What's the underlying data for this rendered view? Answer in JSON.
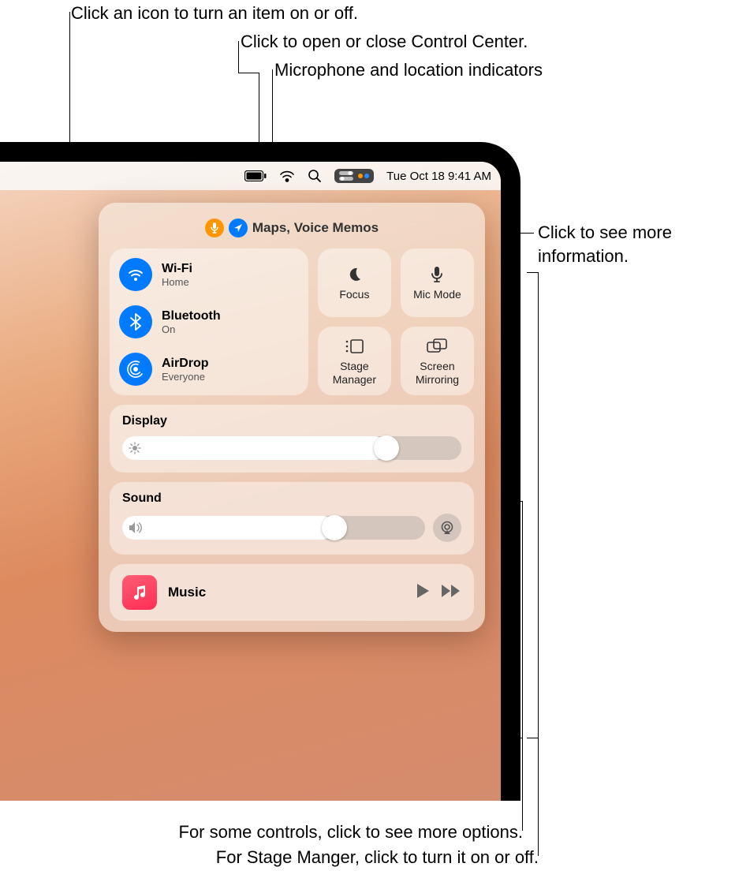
{
  "callouts": {
    "toggle": "Click an icon to turn an item on or off.",
    "open_close": "Click to open or close Control Center.",
    "indicators": "Microphone and location indicators",
    "more_info_1": "Click to see more",
    "more_info_2": "information.",
    "bottom1": "For some controls, click to see more options.",
    "bottom2": "For Stage Manger, click to turn it on or off."
  },
  "menubar": {
    "datetime": "Tue Oct 18  9:41 AM",
    "indicator_colors": {
      "mic": "#ff9500",
      "loc": "#007aff"
    }
  },
  "privacy": {
    "text": "Maps, Voice Memos"
  },
  "connectivity": {
    "wifi": {
      "title": "Wi-Fi",
      "subtitle": "Home"
    },
    "bluetooth": {
      "title": "Bluetooth",
      "subtitle": "On"
    },
    "airdrop": {
      "title": "AirDrop",
      "subtitle": "Everyone"
    }
  },
  "tiles": {
    "focus": "Focus",
    "mic_mode": "Mic Mode",
    "stage_manager": "Stage Manager",
    "screen_mirroring": "Screen Mirroring"
  },
  "display": {
    "label": "Display",
    "value_pct": 78
  },
  "sound": {
    "label": "Sound",
    "value_pct": 70
  },
  "music": {
    "app": "Music"
  }
}
